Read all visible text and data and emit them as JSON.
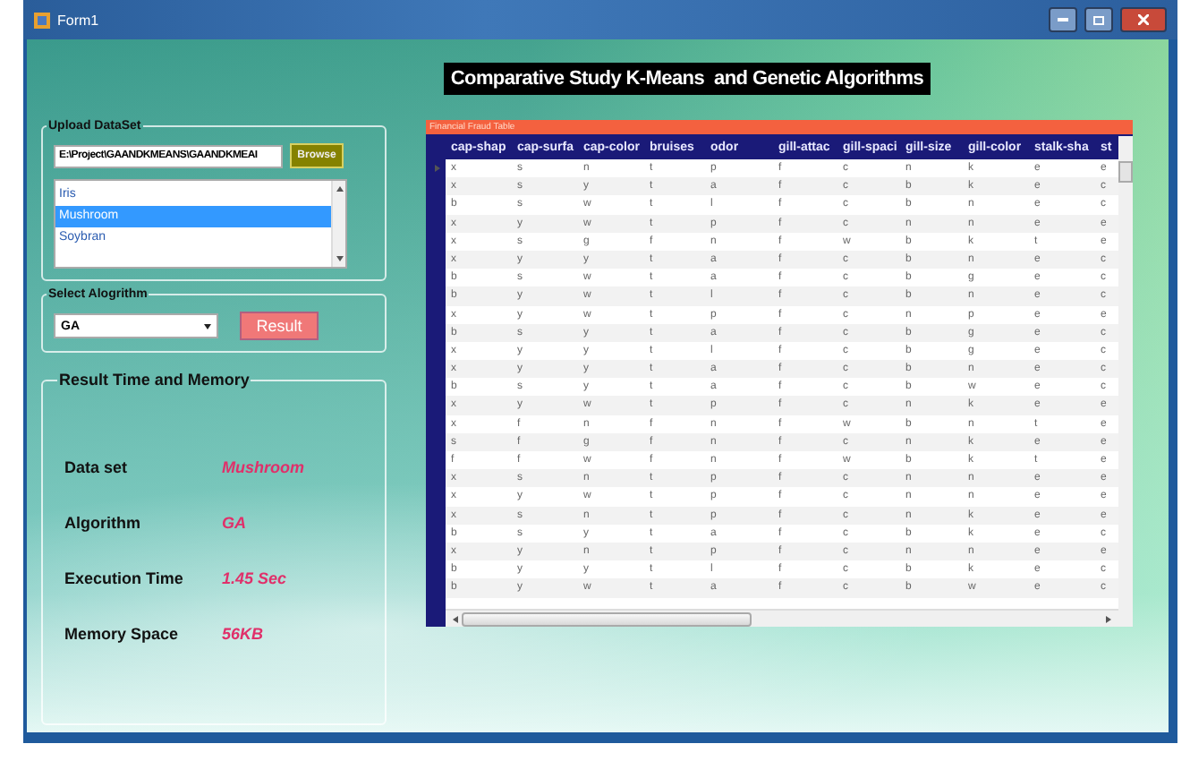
{
  "window": {
    "title": "Form1"
  },
  "heading": "Comparative Study K-Means  and Genetic Algorithms",
  "upload": {
    "legend": "Upload DataSet",
    "path": "E:\\Project\\GAANDKMEANS\\GAANDKMEAI",
    "browse_label": "Browse",
    "datasets": [
      {
        "label": "Iris",
        "selected": false
      },
      {
        "label": "Mushroom",
        "selected": true
      },
      {
        "label": "Soybran",
        "selected": false
      }
    ]
  },
  "algorithm": {
    "legend": "Select Alogrithm",
    "value": "GA",
    "result_label": "Result"
  },
  "result": {
    "legend": "Result Time and Memory",
    "rows": [
      {
        "label": "Data set",
        "value": "Mushroom"
      },
      {
        "label": "Algorithm",
        "value": "GA"
      },
      {
        "label": "Execution Time",
        "value": "1.45 Sec"
      },
      {
        "label": "Memory Space",
        "value": "56KB"
      }
    ]
  },
  "table": {
    "caption": "Financial Fraud Table",
    "columns": [
      "cap-shap",
      "cap-surfa",
      "cap-color",
      "bruises",
      "odor",
      "gill-attac",
      "gill-spaci",
      "gill-size",
      "gill-color",
      "stalk-sha",
      "st"
    ],
    "rows": [
      {
        "current": true,
        "cells": [
          "x",
          "s",
          "n",
          "t",
          "p",
          "f",
          "c",
          "n",
          "k",
          "e",
          "e"
        ]
      },
      {
        "current": false,
        "cells": [
          "x",
          "s",
          "y",
          "t",
          "a",
          "f",
          "c",
          "b",
          "k",
          "e",
          "c"
        ]
      },
      {
        "current": false,
        "cells": [
          "b",
          "s",
          "w",
          "t",
          "l",
          "f",
          "c",
          "b",
          "n",
          "e",
          "c"
        ]
      },
      {
        "current": false,
        "cells": [
          "x",
          "y",
          "w",
          "t",
          "p",
          "f",
          "c",
          "n",
          "n",
          "e",
          "e"
        ]
      },
      {
        "current": false,
        "cells": [
          "x",
          "s",
          "g",
          "f",
          "n",
          "f",
          "w",
          "b",
          "k",
          "t",
          "e"
        ]
      },
      {
        "current": false,
        "cells": [
          "x",
          "y",
          "y",
          "t",
          "a",
          "f",
          "c",
          "b",
          "n",
          "e",
          "c"
        ]
      },
      {
        "current": false,
        "cells": [
          "b",
          "s",
          "w",
          "t",
          "a",
          "f",
          "c",
          "b",
          "g",
          "e",
          "c"
        ]
      },
      {
        "current": false,
        "cells": [
          "b",
          "y",
          "w",
          "t",
          "l",
          "f",
          "c",
          "b",
          "n",
          "e",
          "c"
        ]
      },
      {
        "current": false,
        "cells": [
          "x",
          "y",
          "w",
          "t",
          "p",
          "f",
          "c",
          "n",
          "p",
          "e",
          "e"
        ]
      },
      {
        "current": false,
        "cells": [
          "b",
          "s",
          "y",
          "t",
          "a",
          "f",
          "c",
          "b",
          "g",
          "e",
          "c"
        ]
      },
      {
        "current": false,
        "cells": [
          "x",
          "y",
          "y",
          "t",
          "l",
          "f",
          "c",
          "b",
          "g",
          "e",
          "c"
        ]
      },
      {
        "current": false,
        "cells": [
          "x",
          "y",
          "y",
          "t",
          "a",
          "f",
          "c",
          "b",
          "n",
          "e",
          "c"
        ]
      },
      {
        "current": false,
        "cells": [
          "b",
          "s",
          "y",
          "t",
          "a",
          "f",
          "c",
          "b",
          "w",
          "e",
          "c"
        ]
      },
      {
        "current": false,
        "cells": [
          "x",
          "y",
          "w",
          "t",
          "p",
          "f",
          "c",
          "n",
          "k",
          "e",
          "e"
        ]
      },
      {
        "current": false,
        "cells": [
          "x",
          "f",
          "n",
          "f",
          "n",
          "f",
          "w",
          "b",
          "n",
          "t",
          "e"
        ]
      },
      {
        "current": false,
        "cells": [
          "s",
          "f",
          "g",
          "f",
          "n",
          "f",
          "c",
          "n",
          "k",
          "e",
          "e"
        ]
      },
      {
        "current": false,
        "cells": [
          "f",
          "f",
          "w",
          "f",
          "n",
          "f",
          "w",
          "b",
          "k",
          "t",
          "e"
        ]
      },
      {
        "current": false,
        "cells": [
          "x",
          "s",
          "n",
          "t",
          "p",
          "f",
          "c",
          "n",
          "n",
          "e",
          "e"
        ]
      },
      {
        "current": false,
        "cells": [
          "x",
          "y",
          "w",
          "t",
          "p",
          "f",
          "c",
          "n",
          "n",
          "e",
          "e"
        ]
      },
      {
        "current": false,
        "cells": [
          "x",
          "s",
          "n",
          "t",
          "p",
          "f",
          "c",
          "n",
          "k",
          "e",
          "e"
        ]
      },
      {
        "current": false,
        "cells": [
          "b",
          "s",
          "y",
          "t",
          "a",
          "f",
          "c",
          "b",
          "k",
          "e",
          "c"
        ]
      },
      {
        "current": false,
        "cells": [
          "x",
          "y",
          "n",
          "t",
          "p",
          "f",
          "c",
          "n",
          "n",
          "e",
          "e"
        ]
      },
      {
        "current": false,
        "cells": [
          "b",
          "y",
          "y",
          "t",
          "l",
          "f",
          "c",
          "b",
          "k",
          "e",
          "c"
        ]
      },
      {
        "current": false,
        "cells": [
          "b",
          "y",
          "w",
          "t",
          "a",
          "f",
          "c",
          "b",
          "w",
          "e",
          "c"
        ]
      }
    ]
  }
}
